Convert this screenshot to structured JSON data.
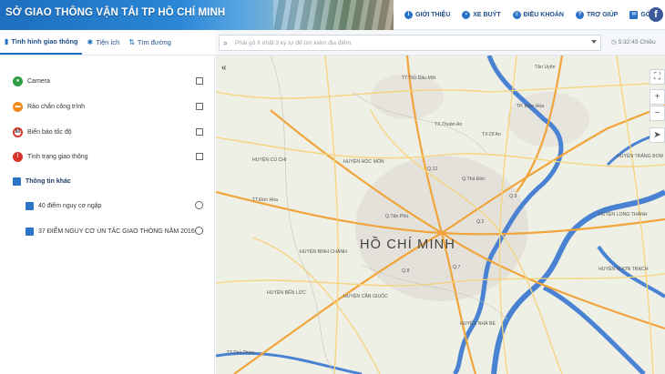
{
  "header": {
    "site_title": "SỞ GIAO THÔNG VẬN TẢI TP HỒ CHÍ MINH",
    "nav": [
      {
        "label": "GIỚI THIỆU",
        "icon": "info-icon"
      },
      {
        "label": "XE BUÝT",
        "icon": "bus-icon"
      },
      {
        "label": "ĐIỀU KHOẢN",
        "icon": "document-icon"
      },
      {
        "label": "TRỢ GIÚP",
        "icon": "help-icon"
      },
      {
        "label": "GÓP Ý",
        "icon": "mail-icon"
      }
    ],
    "social": {
      "label": "f",
      "icon": "facebook-icon"
    }
  },
  "tabs": [
    {
      "label": "Tình hình giao thông",
      "icon": "traffic-icon",
      "active": true
    },
    {
      "label": "Tiện ích",
      "icon": "gear-icon",
      "active": false
    },
    {
      "label": "Tìm đường",
      "icon": "route-icon",
      "active": false
    }
  ],
  "search": {
    "placeholder": "Phải gõ ít nhất 3 ký tự để tìm kiếm địa điểm",
    "value": ""
  },
  "clock": "5:32:43 Chiều",
  "layers": [
    {
      "label": "Camera",
      "icon": "camera-icon",
      "color": "#2e9e44",
      "checked": false
    },
    {
      "label": "Rào chắn công trình",
      "icon": "barrier-icon",
      "color": "#f08a1c",
      "checked": false
    },
    {
      "label": "Biển báo tốc độ",
      "icon": "speed-sign-icon",
      "color": "#d9322b",
      "checked": false
    },
    {
      "label": "Tình trạng giao thông",
      "icon": "traffic-light-icon",
      "color": "#d9322b",
      "checked": false
    }
  ],
  "other_info": {
    "heading": "Thông tin khác",
    "items": [
      {
        "label": "40 điểm nguy cơ ngập",
        "selected": false
      },
      {
        "label": "37 ĐIỂM NGUY CƠ ÙN TẮC GIAO THÔNG NĂM 2016",
        "selected": false
      }
    ]
  },
  "map": {
    "city_label": "HỒ CHÍ MINH",
    "collapse_label": "«",
    "controls": [
      "⛶",
      "+",
      "−",
      "➤"
    ],
    "place_labels": [
      "TT.Thủ Dầu Một",
      "Tân Uyên",
      "TP. Biên Hòa",
      "TX.Thuận An",
      "TX.Dĩ An",
      "HUYỆN HÓC MÔN",
      "Q.Thủ Đức",
      "HUYỆN CỦ CHI",
      "HUYỆN BÌNH CHÁNH",
      "HUYỆN BẾN LỨC",
      "HUYỆN NHÀ BÈ",
      "Q.12",
      "Q.9",
      "Q.Tân Phú",
      "Q.7",
      "Q.8",
      "Q.2",
      "TT.Đức Hòa",
      "TT.Thủ Thừa",
      "HUYỆN CẦN GIUỘC",
      "HUYỆN LONG THÀNH",
      "HUYỆN TRẢNG BOM",
      "HUYỆN NHƠN TRẠCH"
    ],
    "colors": {
      "water": "#4a82d3",
      "major_road": "#f1a43a",
      "road": "#f6d37a",
      "urban": "#e4e2dc",
      "land": "#eef0e6"
    }
  }
}
